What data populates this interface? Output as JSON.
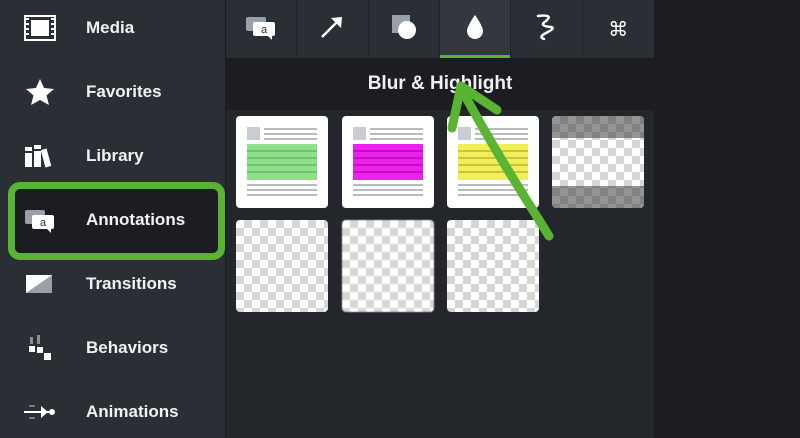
{
  "sidebar": {
    "items": [
      {
        "label": "Media",
        "icon": "film-icon"
      },
      {
        "label": "Favorites",
        "icon": "star-icon"
      },
      {
        "label": "Library",
        "icon": "books-icon"
      },
      {
        "label": "Annotations",
        "icon": "annotation-icon"
      },
      {
        "label": "Transitions",
        "icon": "transition-icon"
      },
      {
        "label": "Behaviors",
        "icon": "behaviors-icon"
      },
      {
        "label": "Animations",
        "icon": "animation-icon"
      }
    ],
    "selected": "Annotations"
  },
  "tabs": [
    {
      "name": "callouts",
      "icon": "callout-icon",
      "glyph": "a"
    },
    {
      "name": "arrows-lines",
      "icon": "arrow-icon"
    },
    {
      "name": "shapes",
      "icon": "shapes-icon"
    },
    {
      "name": "blur-highlight",
      "icon": "droplet-icon",
      "active": true
    },
    {
      "name": "sketch-motion",
      "icon": "squiggle-icon"
    },
    {
      "name": "keystroke",
      "icon": "command-icon",
      "glyph": "⌘"
    }
  ],
  "panel": {
    "title": "Blur & Highlight"
  },
  "thumbnails": [
    {
      "kind": "highlight",
      "color": "#8fe08a"
    },
    {
      "kind": "highlight",
      "color": "#ee22ee"
    },
    {
      "kind": "highlight",
      "color": "#f2ee55"
    },
    {
      "kind": "blur-band"
    },
    {
      "kind": "transparent"
    },
    {
      "kind": "transparent-blur"
    },
    {
      "kind": "transparent"
    }
  ],
  "colors": {
    "accent": "#5ab434",
    "sidebar_bg": "#2a2e35",
    "panel_bg": "#23262b"
  }
}
